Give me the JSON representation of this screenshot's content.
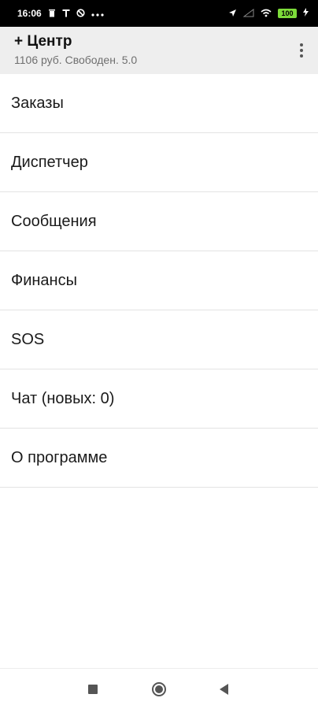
{
  "status_bar": {
    "time": "16:06",
    "battery": "100"
  },
  "app_bar": {
    "title": "+ Центр",
    "subtitle": "1106 руб. Свободен. 5.0"
  },
  "menu": {
    "items": [
      {
        "label": "Заказы"
      },
      {
        "label": "Диспетчер"
      },
      {
        "label": "Сообщения"
      },
      {
        "label": "Финансы"
      },
      {
        "label": "SOS"
      },
      {
        "label": "Чат (новых: 0)"
      },
      {
        "label": "О программе"
      }
    ]
  },
  "icons": {
    "status": [
      "trash-icon",
      "t-icon",
      "no-disturb-icon",
      "more-dots-icon",
      "location-arrow-icon",
      "signal-icon",
      "wifi-icon",
      "battery-icon",
      "charging-bolt-icon"
    ],
    "app_bar": [
      "overflow-menu-icon"
    ],
    "nav": [
      "recents-square-icon",
      "home-circle-icon",
      "back-triangle-icon"
    ]
  },
  "colors": {
    "status_bar_bg": "#000000",
    "app_bar_bg": "#eeeeee",
    "battery_fill": "#7ddc3a",
    "divider": "#e3e3e3"
  }
}
